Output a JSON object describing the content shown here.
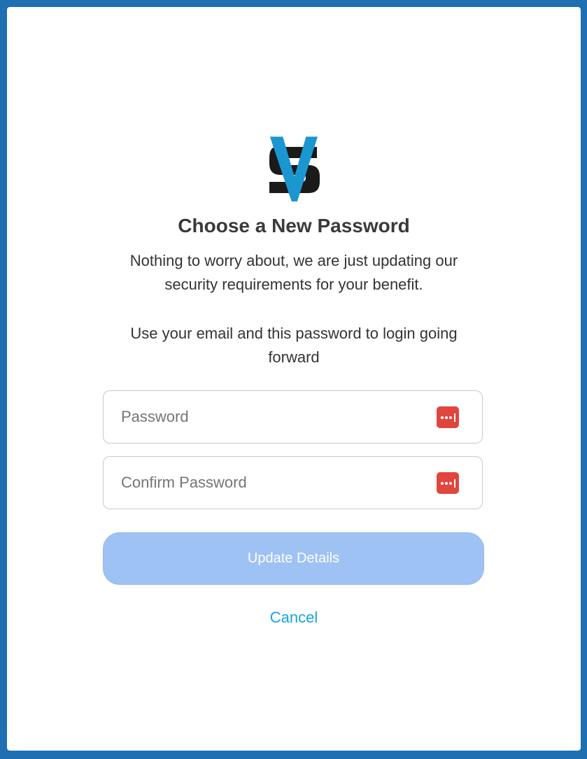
{
  "page": {
    "title": "Choose a New Password",
    "description_1": "Nothing to worry about, we are just updating our security requirements for your benefit.",
    "description_2": "Use your email and this password to login going forward"
  },
  "form": {
    "password": {
      "placeholder": "Password",
      "value": "",
      "icon": "password-manager-icon"
    },
    "confirm_password": {
      "placeholder": "Confirm Password",
      "value": "",
      "icon": "password-manager-icon"
    },
    "submit_label": "Update Details",
    "cancel_label": "Cancel"
  },
  "colors": {
    "background": "#1f6fb2",
    "card": "#ffffff",
    "button": "#9ec2f4",
    "cancel_link": "#1aa3de",
    "password_icon": "#e0463d",
    "logo_accent": "#1a97d0",
    "logo_dark": "#1a1a1a"
  }
}
